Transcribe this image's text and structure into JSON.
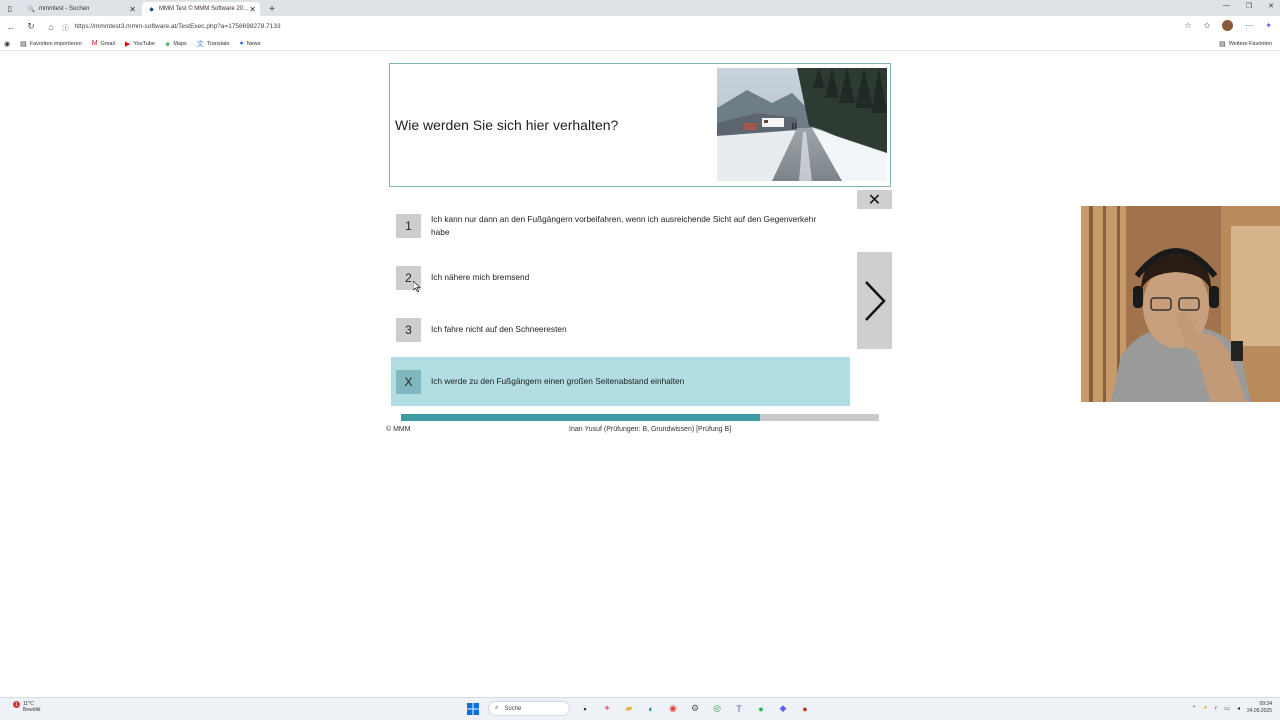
{
  "browser": {
    "tabs": [
      {
        "label": "mmmtest - Suchen",
        "active": false
      },
      {
        "label": "MMM Test © MMM Software 20…",
        "active": true
      }
    ],
    "url": "https://mmmtest3.mmm-software.at/TestExec.php?a=1758698278.7133",
    "bookmarks": {
      "import": "Favoriten importieren",
      "gmail": "Gmail",
      "youtube": "YouTube",
      "maps": "Maps",
      "translate": "Translate",
      "news": "News",
      "more": "Weitere Favoriten"
    }
  },
  "question": {
    "text": "Wie werden Sie sich hier verhalten?"
  },
  "answers": [
    {
      "key": "1",
      "text": "Ich kann nur dann an den Fußgängern vorbeifahren, wenn ich ausreichende Sicht auf den Gegenverkehr habe",
      "selected": false
    },
    {
      "key": "2",
      "text": "Ich nähere mich bremsend",
      "selected": false
    },
    {
      "key": "3",
      "text": "Ich fahre nicht auf den Schneeresten",
      "selected": false
    },
    {
      "key": "X",
      "text": "Ich werde zu den Fußgängern einen großen Seitenabstand einhalten",
      "selected": true
    }
  ],
  "progress": {
    "fraction": 0.75
  },
  "footer": {
    "copyright": "© MMM",
    "user": "Inan Yusuf (Prüfungen: B, Grundwissen) [Prüfung B]"
  },
  "taskbar": {
    "weather_temp": "11°C",
    "weather_desc": "Bewölkt",
    "weather_badge": "1",
    "search_placeholder": "Suche",
    "time": "09:34",
    "date": "24.09.2025"
  },
  "colors": {
    "accent": "#3e9aa4",
    "selected_bg": "#b2dde2",
    "button_bg": "#cfcfcf"
  }
}
